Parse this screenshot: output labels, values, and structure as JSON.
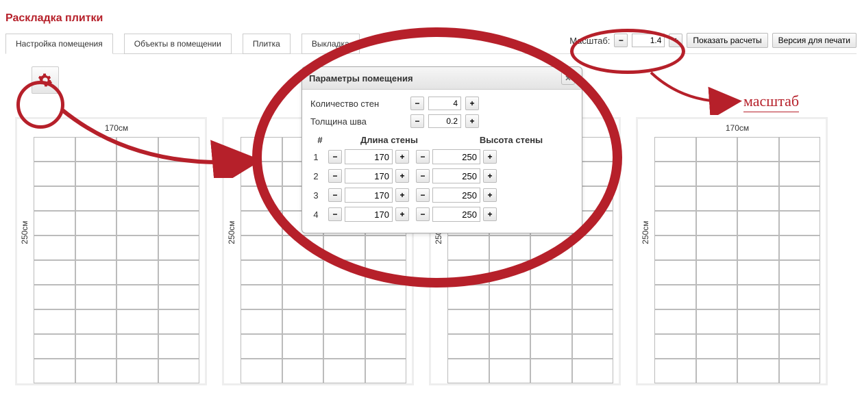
{
  "title": "Раскладка плитки",
  "tabs": [
    {
      "label": "Настройка помещения",
      "active": true
    },
    {
      "label": "Объекты в помещении",
      "active": false
    },
    {
      "label": "Плитка",
      "active": false
    },
    {
      "label": "Выкладка",
      "active": false
    }
  ],
  "scale": {
    "label": "Масштаб:",
    "value": "1.4"
  },
  "buttons": {
    "show_calc": "Показать расчеты",
    "print_ver": "Версия для печати"
  },
  "panel": {
    "title": "Параметры помещения",
    "wall_count_label": "Количество стен",
    "wall_count": "4",
    "seam_label": "Толщина шва",
    "seam": "0.2",
    "col_index": "#",
    "col_len": "Длина стены",
    "col_height": "Высота стены",
    "rows": [
      {
        "n": "1",
        "len": "170",
        "h": "250"
      },
      {
        "n": "2",
        "len": "170",
        "h": "250"
      },
      {
        "n": "3",
        "len": "170",
        "h": "250"
      },
      {
        "n": "4",
        "len": "170",
        "h": "250"
      }
    ]
  },
  "wall": {
    "top": "170см",
    "left": "250см"
  },
  "annot": {
    "scale_text": "масштаб"
  },
  "glyph": {
    "minus": "−",
    "plus": "+",
    "close": "✕"
  }
}
